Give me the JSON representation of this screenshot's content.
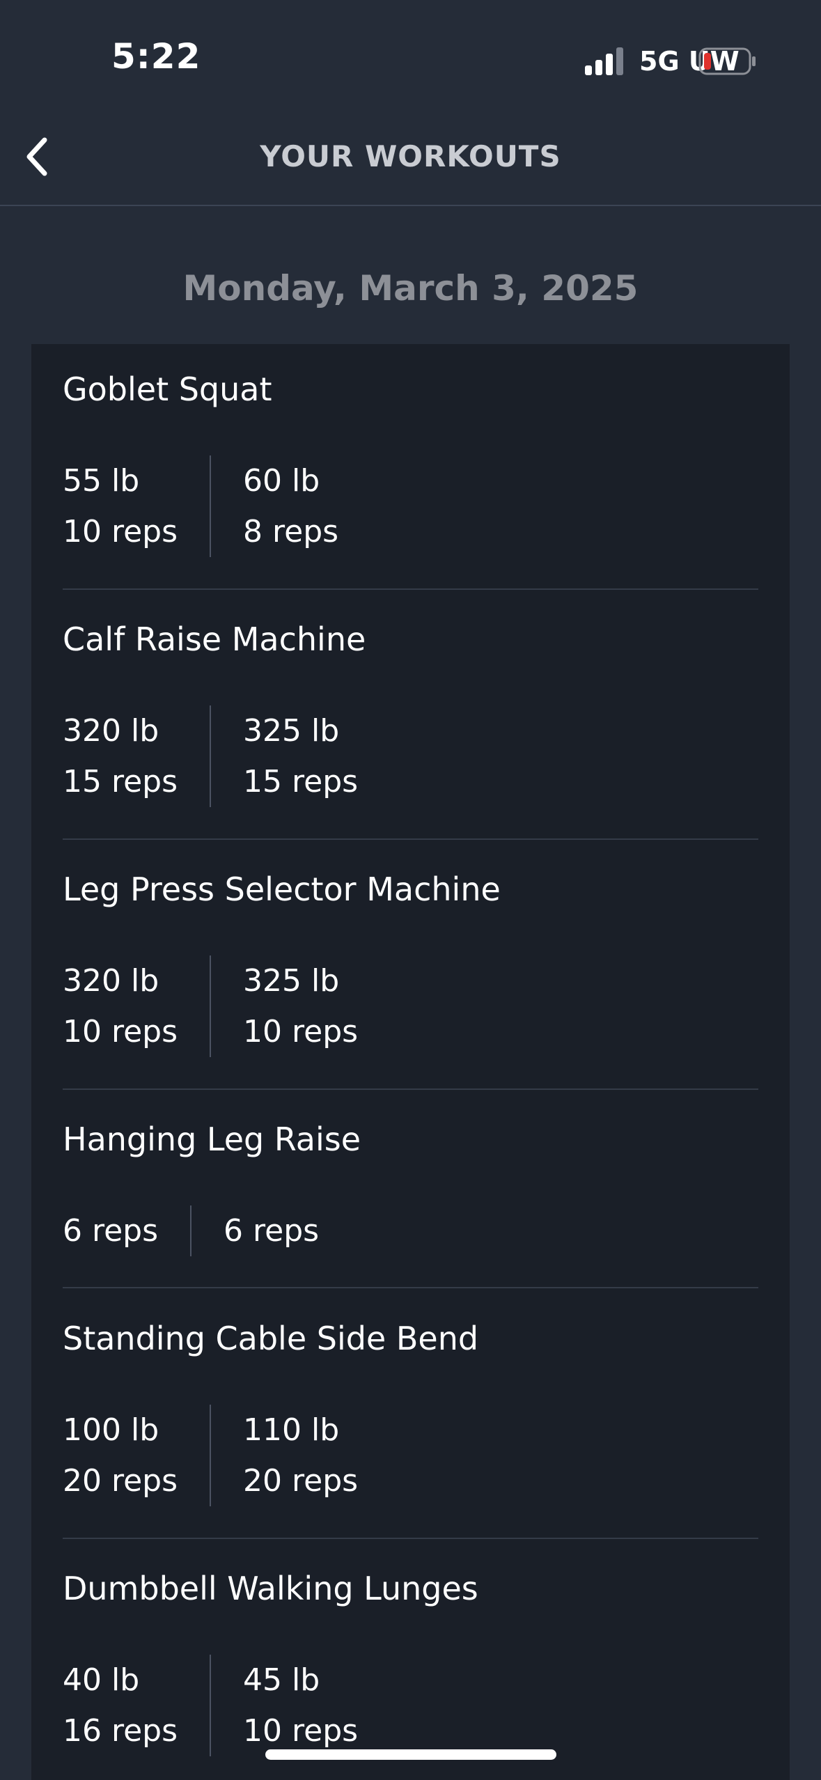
{
  "status_bar": {
    "time": "5:22",
    "network": "5G UW",
    "signal_icon": "signal-bars-icon",
    "battery_icon": "battery-low-icon",
    "battery_color": "#e0322d"
  },
  "header": {
    "title": "YOUR WORKOUTS",
    "back_icon": "chevron-left-icon"
  },
  "date": "Monday, March 3, 2025",
  "workouts": [
    {
      "name": "Goblet Squat",
      "sets": [
        {
          "weight": "55 lb",
          "reps": "10 reps"
        },
        {
          "weight": "60 lb",
          "reps": "8 reps"
        }
      ]
    },
    {
      "name": "Calf Raise Machine",
      "sets": [
        {
          "weight": "320 lb",
          "reps": "15 reps"
        },
        {
          "weight": "325 lb",
          "reps": "15 reps"
        }
      ]
    },
    {
      "name": "Leg Press Selector Machine",
      "sets": [
        {
          "weight": "320 lb",
          "reps": "10 reps"
        },
        {
          "weight": "325 lb",
          "reps": "10 reps"
        }
      ]
    },
    {
      "name": "Hanging Leg Raise",
      "sets": [
        {
          "reps": "6 reps"
        },
        {
          "reps": "6 reps"
        }
      ]
    },
    {
      "name": "Standing Cable Side Bend",
      "sets": [
        {
          "weight": "100 lb",
          "reps": "20 reps"
        },
        {
          "weight": "110 lb",
          "reps": "20 reps"
        }
      ]
    },
    {
      "name": "Dumbbell Walking Lunges",
      "sets": [
        {
          "weight": "40 lb",
          "reps": "16 reps"
        },
        {
          "weight": "45 lb",
          "reps": "10 reps"
        }
      ]
    }
  ]
}
